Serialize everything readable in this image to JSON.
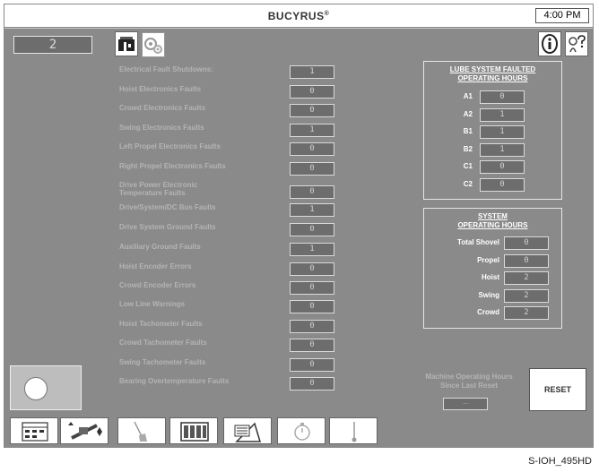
{
  "header": {
    "brand": "BUCYRUS",
    "brand_mark": "®",
    "time": "4:00 PM"
  },
  "left": {
    "mode_value": "2"
  },
  "tabs": {
    "icons": [
      "shovel-icon",
      "gears-icon"
    ],
    "right_icons": [
      "info-icon",
      "help-icon"
    ]
  },
  "faults": [
    {
      "label": "Electrical Fault Shutdowns:",
      "value": "1"
    },
    {
      "label": "Hoist Electronics Faults",
      "value": "0"
    },
    {
      "label": "Crowd Electronics Faults",
      "value": "0"
    },
    {
      "label": "Swing Electronics Faults",
      "value": "1"
    },
    {
      "label": "Left Propel Electronics Faults",
      "value": "0"
    },
    {
      "label": "Right Propel Electronics Faults",
      "value": "0"
    },
    {
      "label": "Drive Power Electronic Temperature Faults",
      "value": "0"
    },
    {
      "label": "Drive/System/DC Bus Faults",
      "value": "1"
    },
    {
      "label": "Drive System Ground Faults",
      "value": "0"
    },
    {
      "label": "Auxiliary Ground Faults",
      "value": "1"
    },
    {
      "label": "Hoist Encoder Errors",
      "value": "0"
    },
    {
      "label": "Crowd Encoder Errors",
      "value": "0"
    },
    {
      "label": "Low Line Warnings",
      "value": "0"
    },
    {
      "label": "Hoist Tachometer Faults",
      "value": "0"
    },
    {
      "label": "Crowd Tachometer Faults",
      "value": "0"
    },
    {
      "label": "Swing Tachometer Faults",
      "value": "0"
    },
    {
      "label": "Bearing Overtemperature Faults",
      "value": "0"
    }
  ],
  "lube": {
    "title_line1": "LUBE SYSTEM FAULTED",
    "title_line2": "OPERATING HOURS",
    "items": [
      {
        "label": "A1",
        "value": "0"
      },
      {
        "label": "A2",
        "value": "1"
      },
      {
        "label": "B1",
        "value": "1"
      },
      {
        "label": "B2",
        "value": "1"
      },
      {
        "label": "C1",
        "value": "0"
      },
      {
        "label": "C2",
        "value": "0"
      }
    ]
  },
  "system": {
    "title_line1": "SYSTEM",
    "title_line2": "OPERATING HOURS",
    "items": [
      {
        "label": "Total Shovel",
        "value": "0"
      },
      {
        "label": "Propel",
        "value": "0"
      },
      {
        "label": "Hoist",
        "value": "2"
      },
      {
        "label": "Swing",
        "value": "2"
      },
      {
        "label": "Crowd",
        "value": "2"
      }
    ]
  },
  "machine": {
    "label_line1": "Machine Operating Hours",
    "label_line2": "Since Last Reset",
    "value": "...",
    "reset_label": "RESET"
  },
  "toolbar": {
    "tools": [
      "display-icon",
      "joystick-icon",
      "brush-icon",
      "bins-icon",
      "triangle-note-icon",
      "timer-icon",
      "thermometer-icon"
    ]
  },
  "caption": "S-IOH_495HD"
}
